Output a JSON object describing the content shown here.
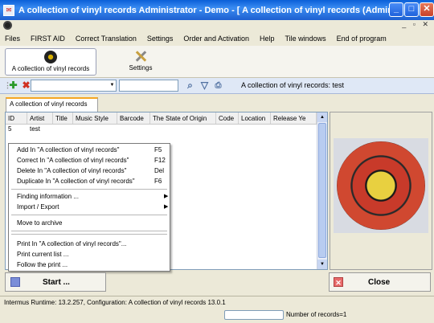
{
  "window": {
    "title": "A collection of vinyl records  Administrator - Demo - [      A collection of vinyl records (Administ...",
    "minimize": "_",
    "maximize": "□",
    "close": "✕"
  },
  "menu": [
    "Files",
    "FIRST AID",
    "Correct Translation",
    "Settings",
    "Order and Activation",
    "Help",
    "Tile windows",
    "End of program"
  ],
  "modules": {
    "active_label": "A collection of vinyl records",
    "settings_label": "Settings"
  },
  "toolbar": {
    "status": "A collection of vinyl records: test"
  },
  "tab": "A collection of vinyl records",
  "grid": {
    "columns": [
      "ID",
      "Artist",
      "Title",
      "Music Style",
      "Barcode",
      "The State of Origin",
      "Code",
      "Location",
      "Release Ye"
    ],
    "rows": [
      [
        "5",
        "test",
        "",
        "",
        "",
        "",
        "",
        "",
        ""
      ]
    ]
  },
  "context_menu": {
    "add": "Add  In \"A collection of vinyl records\"",
    "add_sc": "F5",
    "correct": "Correct  In \"A collection of vinyl records\"",
    "correct_sc": "F12",
    "delete": "Delete  In \"A collection of vinyl records\"",
    "delete_sc": "Del",
    "duplicate": "Duplicate  In \"A collection of vinyl records\"",
    "duplicate_sc": "F6",
    "finding": "Finding information ...",
    "import_export": "Import / Export",
    "archive": "Move to archive",
    "print_in": "Print  In \"A collection of vinyl records\"...",
    "print_list": "Print current list ...",
    "follow_print": "Follow the print ...",
    "submenu_arrow": "▶"
  },
  "buttons": {
    "start": "Start ...",
    "close": "Close"
  },
  "status": {
    "runtime": "Intermus Runtime: 13.2.257, Configuration: A collection of vinyl records 13.0.1",
    "records": "Number of records=1"
  }
}
